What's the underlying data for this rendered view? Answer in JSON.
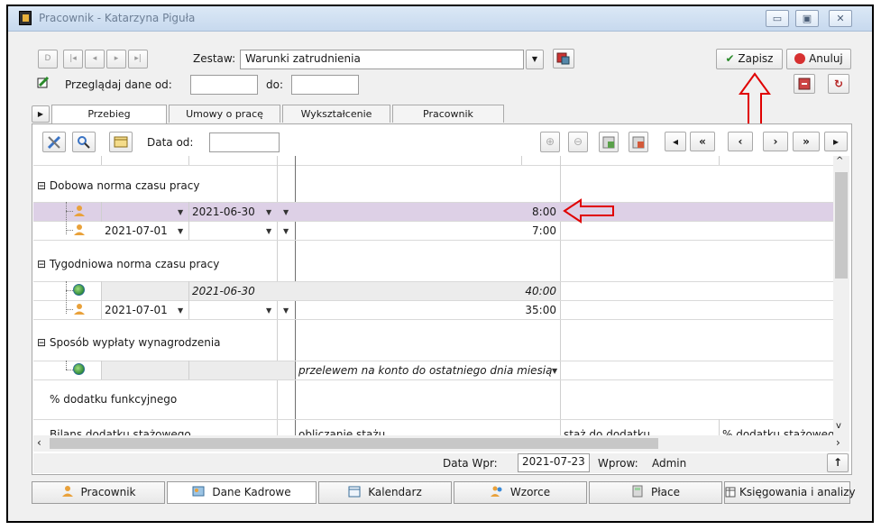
{
  "window": {
    "title": "Pracownik - Katarzyna Piguła",
    "controls": [
      "minimize",
      "maximize",
      "close"
    ]
  },
  "toolbar": {
    "nav_buttons": [
      "D",
      "|◂",
      "◂",
      "▸",
      "▸|"
    ],
    "zestaw_label": "Zestaw:",
    "zestaw_value": "Warunki zatrudnienia",
    "save_label": "Zapisz",
    "cancel_label": "Anuluj"
  },
  "filter": {
    "browse_label": "Przeglądaj dane od:",
    "to_label": "do:",
    "from_value": "",
    "to_value": ""
  },
  "tabs": [
    "Przebieg zatrudnienia...",
    "Umowy o pracę",
    "Wykształcenie",
    "Pracownik"
  ],
  "grid_toolbar": {
    "date_from_label": "Data od:",
    "date_from_value": "",
    "nav": [
      "◂",
      "«",
      "‹",
      "›",
      "»",
      "▸"
    ]
  },
  "sections": {
    "daily": {
      "title": "Dobowa norma czasu pracy",
      "row1": {
        "date_to": "2021-06-30",
        "value": "8:00"
      },
      "row2": {
        "date_from": "2021-07-01",
        "value": "7:00"
      }
    },
    "weekly": {
      "title": "Tygodniowa norma czasu pracy",
      "row1": {
        "date_to": "2021-06-30",
        "value": "40:00"
      },
      "row2": {
        "date_from": "2021-07-01",
        "value": "35:00"
      }
    },
    "payment": {
      "title": "Sposób wypłaty wynagrodzenia",
      "row1": {
        "value": "przelewem na konto do ostatniego dnia miesiąca..."
      }
    },
    "allowance": {
      "title": "% dodatku funkcyjnego"
    },
    "seniority": {
      "title": "Bilans dodatku stażowego",
      "col1": "obliczanie stażu",
      "col2": "staż do dodatku",
      "col3": "% dodatku stażowego"
    }
  },
  "status": {
    "entry_date_label": "Data Wpr:",
    "entry_date_value": "2021-07-23",
    "entered_by_label": "Wprow:",
    "entered_by_value": "Admin"
  },
  "bottom_tabs": [
    "Pracownik",
    "Dane Kadrowe",
    "Kalendarz",
    "Wzorce",
    "Płace",
    "Księgowania i analizy"
  ],
  "colors": {
    "selected_row": "#ddd0e6",
    "annotation": "#e00000",
    "accent": "#2a8a2a"
  }
}
